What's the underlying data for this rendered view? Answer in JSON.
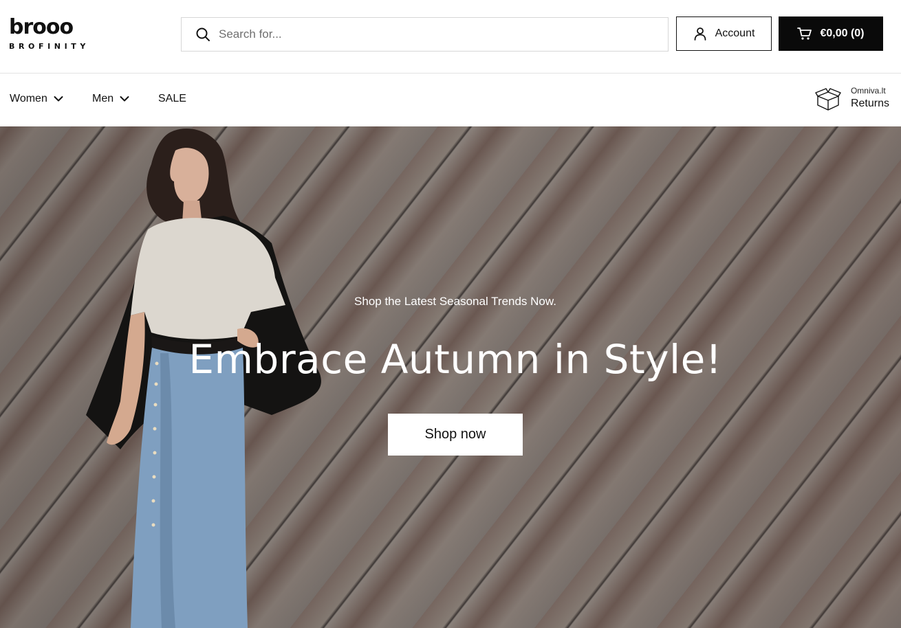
{
  "brand": {
    "logo_text": "brooo",
    "logo_subtext": "BROFINITY"
  },
  "search": {
    "placeholder": "Search for...",
    "icon": "search-icon"
  },
  "header": {
    "account_label": "Account",
    "account_icon": "user-icon",
    "cart_label": "€0,00 (0)",
    "cart_icon": "cart-icon"
  },
  "nav": {
    "items": [
      {
        "label": "Women",
        "has_dropdown": true
      },
      {
        "label": "Men",
        "has_dropdown": true
      },
      {
        "label": "SALE",
        "has_dropdown": false
      }
    ],
    "returns": {
      "small": "Omniva.lt",
      "big": "Returns",
      "icon": "box-icon"
    }
  },
  "hero": {
    "subtitle": "Shop the Latest Seasonal Trends Now.",
    "title": "Embrace Autumn in Style!",
    "cta_label": "Shop now"
  },
  "colors": {
    "primary": "#0a0a0a",
    "background": "#ffffff",
    "hero_text": "#ffffff"
  }
}
